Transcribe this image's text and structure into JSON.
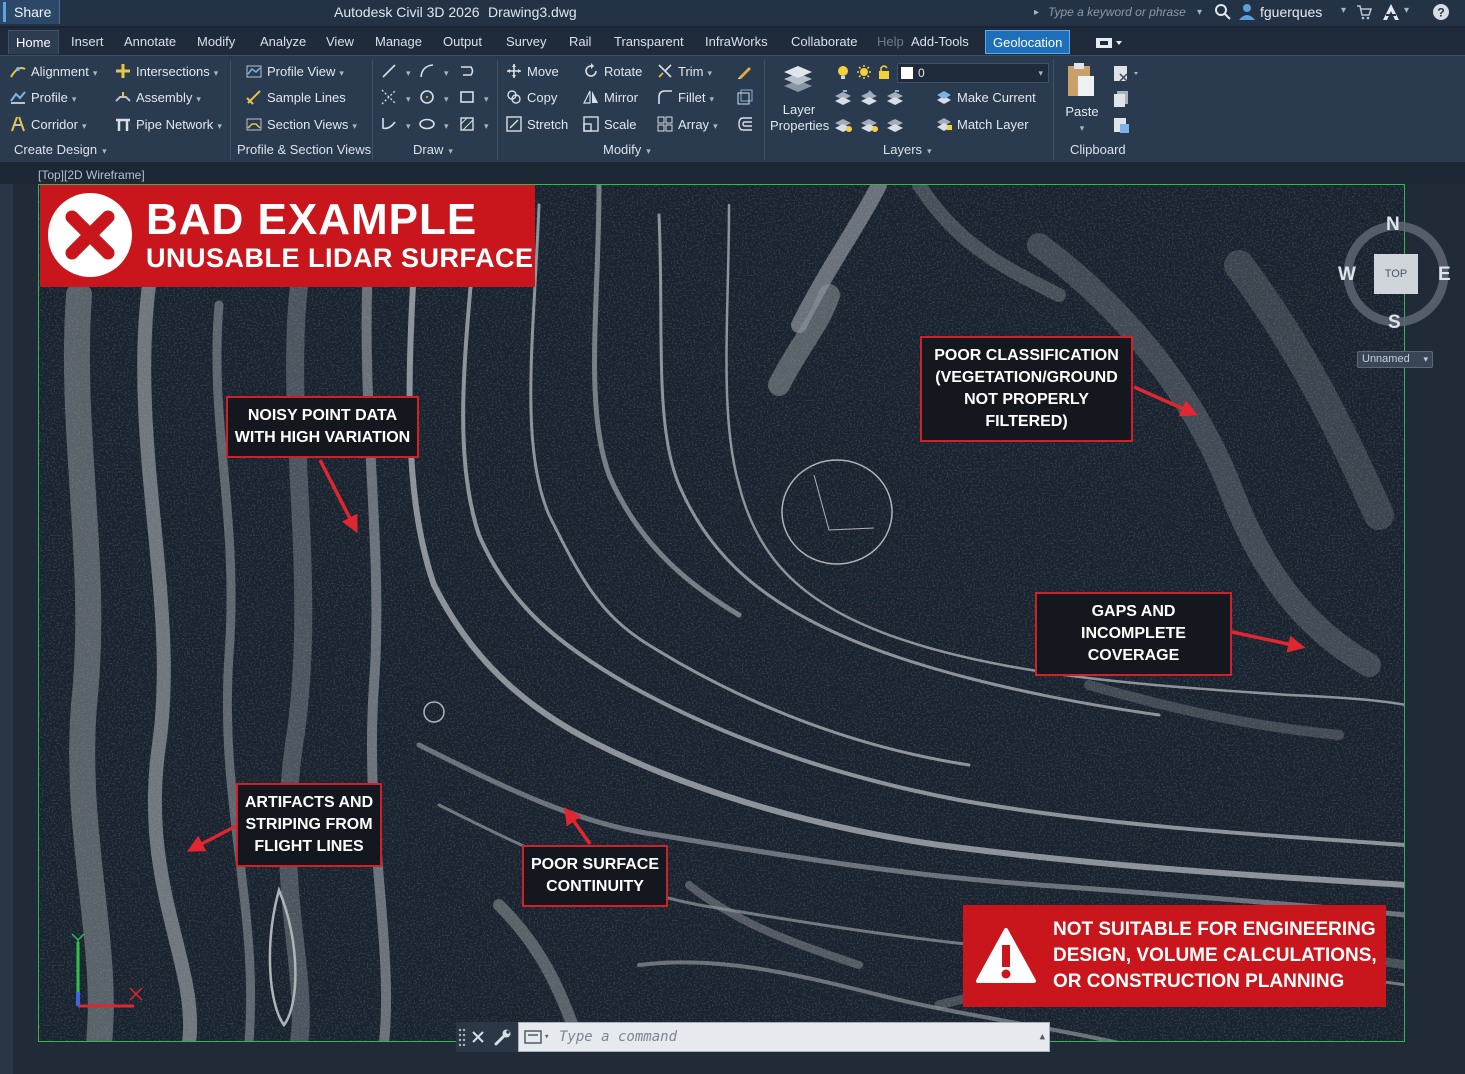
{
  "titlebar": {
    "share": "Share",
    "app_title": "Autodesk Civil 3D 2026",
    "doc_title": "Drawing3.dwg",
    "search_placeholder": "Type a keyword or phrase",
    "user": "fguerques"
  },
  "tabs": [
    "Home",
    "Insert",
    "Annotate",
    "Modify",
    "Analyze",
    "View",
    "Manage",
    "Output",
    "Survey",
    "Rail",
    "Transparent",
    "InfraWorks",
    "Collaborate",
    "Help",
    "Add-Tools",
    "Geolocation"
  ],
  "ribbon": {
    "create_design": {
      "items": [
        "Alignment",
        "Profile",
        "Corridor",
        "Intersections",
        "Assembly",
        "Pipe Network"
      ],
      "label": "Create Design"
    },
    "profile_section": {
      "items": [
        "Profile View",
        "Sample Lines",
        "Section Views"
      ],
      "label": "Profile & Section Views"
    },
    "draw": {
      "label": "Draw"
    },
    "modify": {
      "items": [
        "Move",
        "Copy",
        "Stretch",
        "Rotate",
        "Mirror",
        "Scale",
        "Trim",
        "Fillet",
        "Array"
      ],
      "label": "Modify"
    },
    "layers": {
      "layer_properties": "Layer Properties",
      "current_layer": "0",
      "make_current": "Make Current",
      "match_layer": "Match Layer",
      "label": "Layers"
    },
    "clipboard": {
      "paste": "Paste",
      "label": "Clipboard"
    }
  },
  "viewport": {
    "label": "[Top][2D Wireframe]",
    "banner": {
      "title": "BAD EXAMPLE",
      "subtitle": "UNUSABLE LIDAR SURFACE"
    },
    "callouts": {
      "noisy": "NOISY POINT DATA\nWITH HIGH VARIATION",
      "classification": "POOR CLASSIFICATION\n(VEGETATION/GROUND\nNOT PROPERLY FILTERED)",
      "gaps": "GAPS AND\nINCOMPLETE COVERAGE",
      "artifacts": "ARTIFACTS AND\nSTRIPING FROM\nFLIGHT LINES",
      "continuity": "POOR SURFACE\nCONTINUITY"
    },
    "warning": "NOT SUITABLE FOR ENGINEERING\nDESIGN, VOLUME CALCULATIONS,\nOR CONSTRUCTION PLANNING",
    "compass": {
      "n": "N",
      "s": "S",
      "e": "E",
      "w": "W",
      "top": "TOP"
    },
    "ucs_name": "Unnamed"
  },
  "command": {
    "placeholder": "Type a command"
  },
  "colors": {
    "alert_red": "#c9161c",
    "geolocation_tab": "#1c6fb8",
    "viewport_border": "#35b552"
  }
}
